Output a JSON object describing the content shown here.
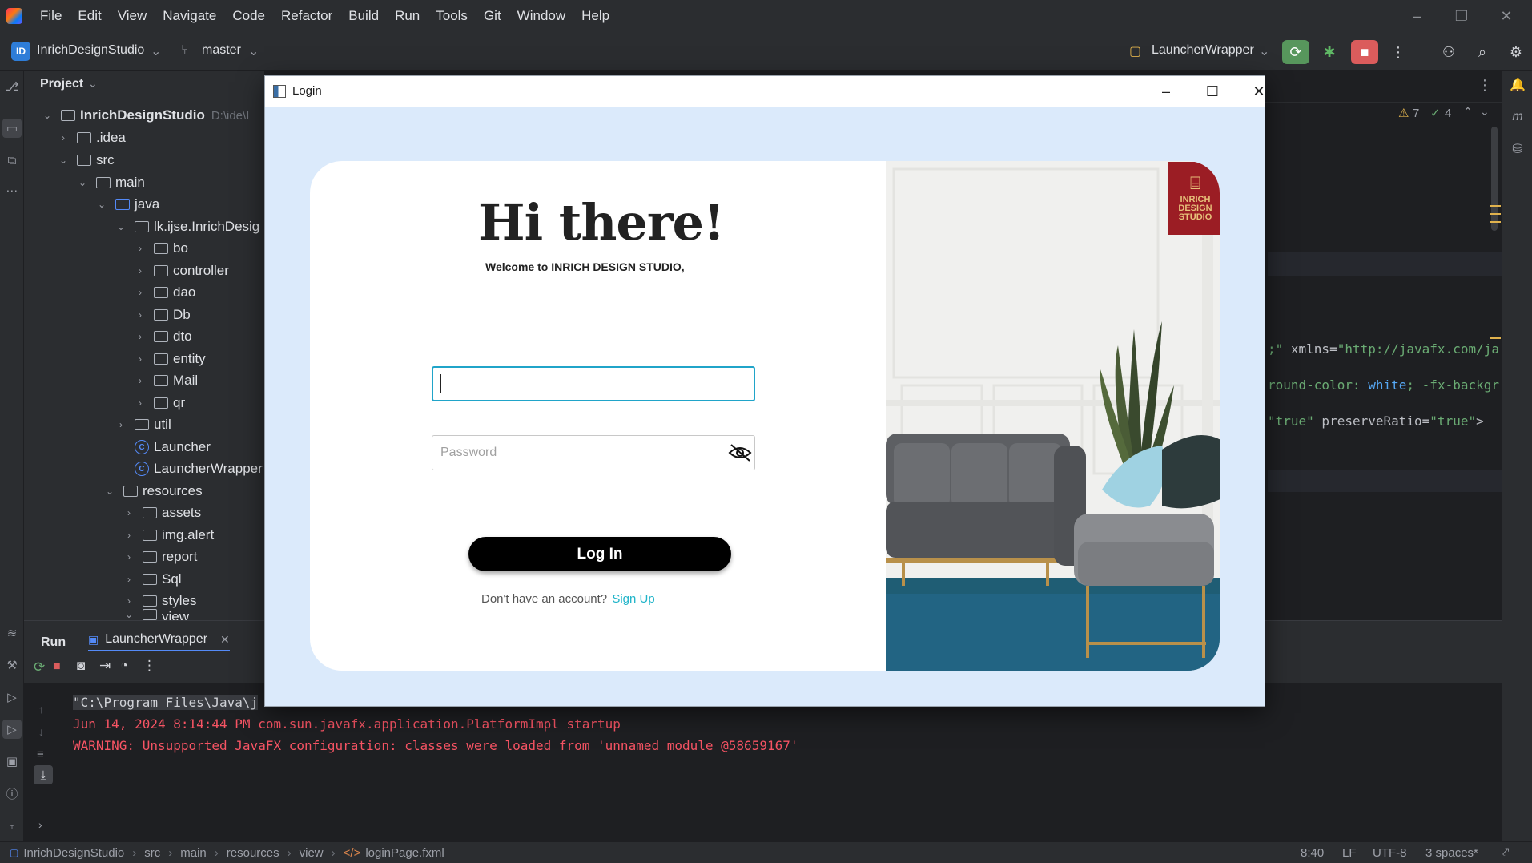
{
  "menubar": {
    "items": [
      "File",
      "Edit",
      "View",
      "Navigate",
      "Code",
      "Refactor",
      "Build",
      "Run",
      "Tools",
      "Git",
      "Window",
      "Help"
    ]
  },
  "toolbar": {
    "project_badge": "ID",
    "project_name": "InrichDesignStudio",
    "branch": "master",
    "run_config": "LauncherWrapper"
  },
  "project_panel": {
    "title": "Project",
    "root": "InrichDesignStudio",
    "root_path": "D:\\ide\\I",
    "tree": [
      {
        "label": ".idea"
      },
      {
        "label": "src"
      },
      {
        "label": "main"
      },
      {
        "label": "java"
      },
      {
        "label": "lk.ijse.InrichDesig"
      },
      {
        "label": "bo"
      },
      {
        "label": "controller"
      },
      {
        "label": "dao"
      },
      {
        "label": "Db"
      },
      {
        "label": "dto"
      },
      {
        "label": "entity"
      },
      {
        "label": "Mail"
      },
      {
        "label": "qr"
      },
      {
        "label": "util"
      },
      {
        "label": "Launcher"
      },
      {
        "label": "LauncherWrapper"
      },
      {
        "label": "resources"
      },
      {
        "label": "assets"
      },
      {
        "label": "img.alert"
      },
      {
        "label": "report"
      },
      {
        "label": "Sql"
      },
      {
        "label": "styles"
      },
      {
        "label": "view"
      }
    ]
  },
  "editor": {
    "warnings": "7",
    "checks": "4",
    "code": {
      "line1_a": ";\"",
      "line1_b": " xmlns=",
      "line1_c": "\"http://javafx.com/ja",
      "line2_a": "round-color: ",
      "line2_b": "white",
      "line2_c": "; -fx-backgr",
      "line3_a": "\"true\"",
      "line3_b": " preserveRatio=",
      "line3_c": "\"true\"",
      "line3_d": ">"
    }
  },
  "run_panel": {
    "tab_run": "Run",
    "tab_config": "LauncherWrapper",
    "console": [
      "\"C:\\Program Files\\Java\\j",
      "Jun 14, 2024 8:14:44 PM com.sun.javafx.application.PlatformImpl startup",
      "WARNING: Unsupported JavaFX configuration: classes were loaded from 'unnamed module @58659167'"
    ]
  },
  "statusbar": {
    "crumbs": [
      "InrichDesignStudio",
      "src",
      "main",
      "resources",
      "view",
      "loginPage.fxml"
    ],
    "position": "8:40",
    "line_sep": "LF",
    "encoding": "UTF-8",
    "indent": "3 spaces*"
  },
  "login": {
    "window_title": "Login",
    "greeting": "Hi there!",
    "welcome": "Welcome to INRICH DESIGN STUDIO,",
    "username_value": "",
    "password_placeholder": "Password",
    "login_button": "Log In",
    "signup_prompt": "Don't have an account?",
    "signup_link": "Sign Up",
    "brand_lines": [
      "INRICH",
      "DESIGN",
      "STUDIO"
    ]
  },
  "colors": {
    "accent_teal": "#20b4c9",
    "brand_red": "#9b1d24",
    "console_error": "#f75464",
    "run_green": "#57965c",
    "stop_red": "#db5c5c"
  }
}
